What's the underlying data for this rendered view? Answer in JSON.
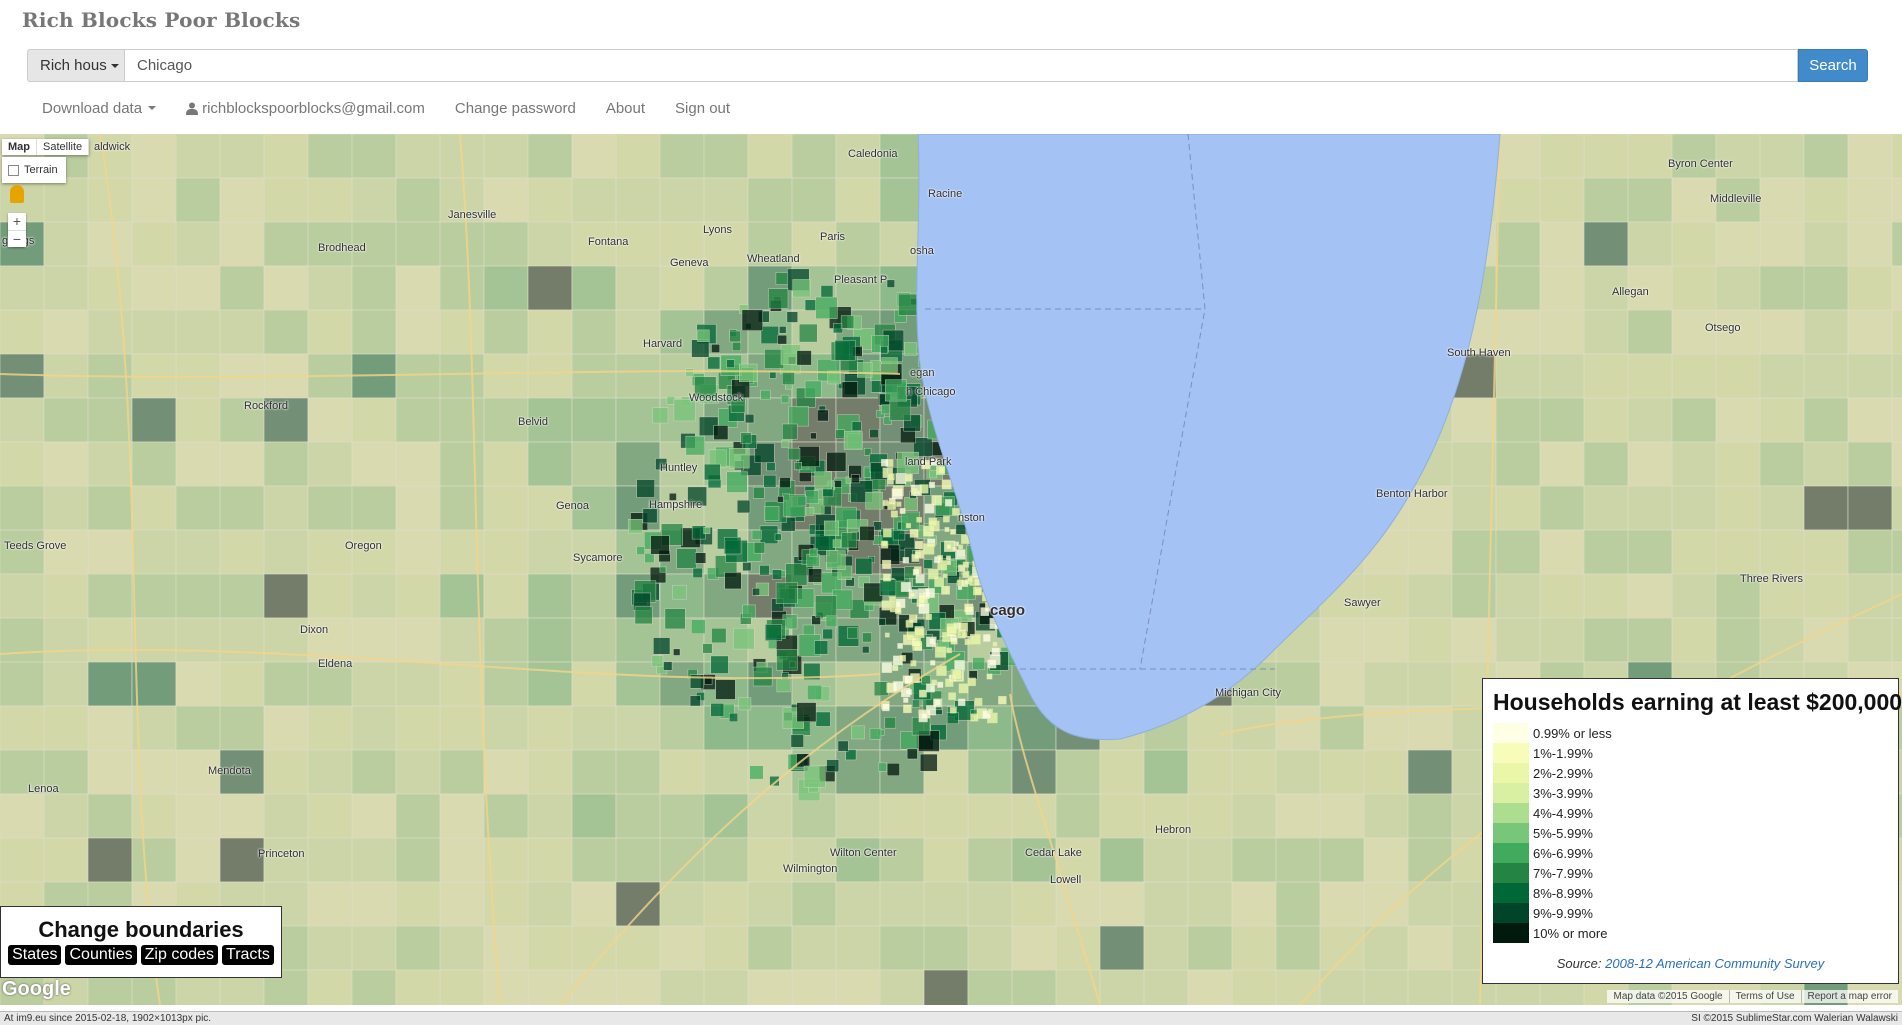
{
  "app": {
    "title": "Rich Blocks Poor Blocks"
  },
  "search": {
    "type_label": "Rich hous",
    "query": "Chicago",
    "button": "Search"
  },
  "nav": {
    "download": "Download data",
    "email": "richblockspoorblocks@gmail.com",
    "change_password": "Change password",
    "about": "About",
    "sign_out": "Sign out"
  },
  "map_controls": {
    "map": "Map",
    "satellite": "Satellite",
    "terrain": "Terrain",
    "zoom_in": "+",
    "zoom_out": "−"
  },
  "places": {
    "caledonia": "Caledonia",
    "racine": "Racine",
    "janesville": "Janesville",
    "kenosha": "osha",
    "lyons": "Lyons",
    "paris": "Paris",
    "pleasant_prairie": "Pleasant P",
    "brodhead": "Brodhead",
    "fontana": "Fontana",
    "geneva": "Geneva",
    "wheatland": "Wheatland",
    "waukegan": "egan",
    "north_chicago": "h Chicago",
    "highland_park": "land Park",
    "woodstock": "Woodstock",
    "rockford": "Rockford",
    "belvidere": "Belvid",
    "harvard": "Harvard",
    "huntley": "Huntley",
    "hampshire": "Hampshire",
    "genoa": "Genoa",
    "evanston": "nston",
    "chicago": "cago",
    "sycamore": "Sycamore",
    "oregon": "Oregon",
    "dixon": "Dixon",
    "eldena": "Eldena",
    "teeds_grove": "Teeds Grove",
    "wilmington": "Wilmington",
    "wilton_center": "Wilton Center",
    "lowell": "Lowell",
    "hebron": "Hebron",
    "cedar_lake": "Cedar Lake",
    "princeton": "Princeton",
    "mendota": "Mendota",
    "lenoa": "Lenoa",
    "michigan_city": "Michigan City",
    "south_haven": "South Haven",
    "benton_harbor": "Benton Harbor",
    "middleville": "Middleville",
    "allegan": "Allegan",
    "otsego": "Otsego",
    "three_rivers": "Three Rivers",
    "sawyer": "Sawyer",
    "eggings": "ggings",
    "caldwick": "aldwick",
    "byron_center": "Byron Center"
  },
  "boundaries": {
    "title": "Change boundaries",
    "buttons": [
      "States",
      "Counties",
      "Zip codes",
      "Tracts"
    ]
  },
  "legend": {
    "title": "Households earning at least $200,000",
    "items": [
      {
        "label": "0.99% or less",
        "color": "#ffffe5"
      },
      {
        "label": "1%-1.99%",
        "color": "#f7fcb9"
      },
      {
        "label": "2%-2.99%",
        "color": "#eaf7a8"
      },
      {
        "label": "3%-3.99%",
        "color": "#d9f0a3"
      },
      {
        "label": "4%-4.99%",
        "color": "#addd8e"
      },
      {
        "label": "5%-5.99%",
        "color": "#78c679"
      },
      {
        "label": "6%-6.99%",
        "color": "#41ab5d"
      },
      {
        "label": "7%-7.99%",
        "color": "#238443"
      },
      {
        "label": "8%-8.99%",
        "color": "#006837"
      },
      {
        "label": "9%-9.99%",
        "color": "#004529"
      },
      {
        "label": "10% or more",
        "color": "#001a0d"
      }
    ],
    "source_prefix": "Source: ",
    "source_link": "2008-12 American Community Survey"
  },
  "attribution": {
    "google": "Google",
    "map_data": "Map data ©2015 Google",
    "terms": "Terms of Use",
    "report": "Report a map error"
  },
  "footer": {
    "left": "At im9.eu since 2015-02-18, 1902×1013px pic.",
    "right": "SI ©2015 SublimeStar.com Walerian Walawski"
  },
  "colors": {
    "lake": "#a4c2f4",
    "primary": "#428bca"
  }
}
